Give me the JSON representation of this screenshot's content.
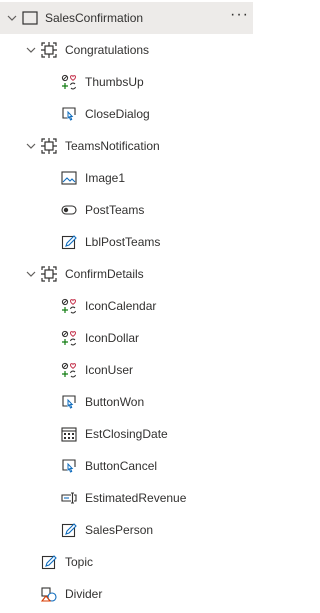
{
  "tree": {
    "root": {
      "label": "SalesConfirmation",
      "more_label": "···"
    },
    "groups": [
      {
        "label": "Congratulations",
        "children": [
          {
            "label": "ThumbsUp"
          },
          {
            "label": "CloseDialog"
          }
        ]
      },
      {
        "label": "TeamsNotification",
        "children": [
          {
            "label": "Image1"
          },
          {
            "label": "PostTeams"
          },
          {
            "label": "LblPostTeams"
          }
        ]
      },
      {
        "label": "ConfirmDetails",
        "children": [
          {
            "label": "IconCalendar"
          },
          {
            "label": "IconDollar"
          },
          {
            "label": "IconUser"
          },
          {
            "label": "ButtonWon"
          },
          {
            "label": "EstClosingDate"
          },
          {
            "label": "ButtonCancel"
          },
          {
            "label": "EstimatedRevenue"
          },
          {
            "label": "SalesPerson"
          }
        ]
      }
    ],
    "items": [
      {
        "label": "Topic"
      },
      {
        "label": "Divider"
      }
    ]
  },
  "colors": {
    "selected_row": "#edebe9",
    "icon_dark": "#323130",
    "icon_red": "#c4314b",
    "icon_green": "#107c10",
    "icon_accent": "#0f6cbd"
  }
}
